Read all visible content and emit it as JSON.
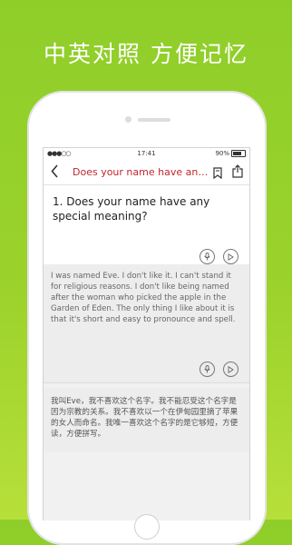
{
  "banner": {
    "text": "中英对照 方便记忆"
  },
  "status_bar": {
    "signal": "●●●○○",
    "time": "17:41",
    "battery": "90%"
  },
  "nav": {
    "back_icon": "chevron-left-icon",
    "title": "Does your name have any...",
    "bookmark_icon": "bookmark-icon",
    "share_icon": "share-icon"
  },
  "question": {
    "text": "1. Does your name have any special meaning?"
  },
  "answer_en": {
    "text": "I was named Eve. I don't like it. I can't stand it for religious reasons. I don't like being named after the woman who picked the apple in the Garden of Eden. The only thing I like about it is that it's short and easy to pronounce and spell."
  },
  "answer_zh": {
    "text": "我叫Eve，我不喜欢这个名字。我不能忍受这个名字是因为宗教的关系。我不喜欢以一个在伊甸园里摘了苹果的女人而命名。我唯一喜欢这个名字的是它够短，方便读，方便拼写。"
  },
  "icons": {
    "mic": "microphone-icon",
    "play": "play-icon"
  },
  "colors": {
    "background": "#9bd22b",
    "title_red": "#c0272d"
  }
}
